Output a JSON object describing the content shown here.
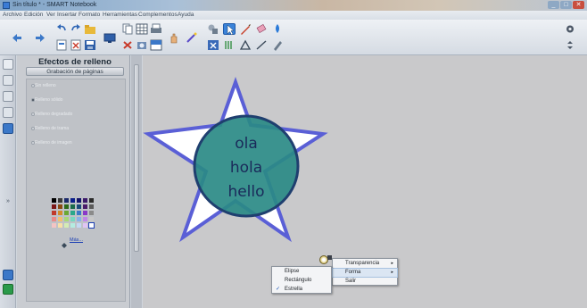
{
  "window": {
    "title": "Sin título * - SMART Notebook",
    "controls": [
      "minimize",
      "maximize",
      "close"
    ]
  },
  "menubar": {
    "items": [
      "Archivo",
      "Edición",
      "Ver",
      "Insertar",
      "Formato",
      "Herramientas",
      "Complementos",
      "Ayuda"
    ]
  },
  "properties_panel": {
    "title": "Efectos de relleno",
    "subtitle": "Grabación de páginas",
    "fill_options": [
      {
        "label": "Sin relleno",
        "selected": false
      },
      {
        "label": "Relleno sólido",
        "selected": true
      },
      {
        "label": "Relleno degradado",
        "selected": false
      },
      {
        "label": "Relleno de trama",
        "selected": false
      },
      {
        "label": "Relleno de imagen",
        "selected": false
      }
    ],
    "more_colors_link": "Más...",
    "palette": [
      "#000000",
      "#3a3a3a",
      "#1b2a6b",
      "#0b1f8a",
      "#14146a",
      "#3c1a6a",
      "#2a2a2a",
      "#7a1616",
      "#8a4a12",
      "#2e6a1a",
      "#1a6a4a",
      "#1a4a7a",
      "#4a1a6a",
      "#5a5a5a",
      "#c0392b",
      "#d38b2a",
      "#6aa832",
      "#2aa88a",
      "#3a7ac8",
      "#8a3ac8",
      "#8a8a8a",
      "#e88a8a",
      "#f0c070",
      "#a8d878",
      "#78d8c0",
      "#88b0e8",
      "#c088e8",
      "#c8c8c8",
      "#f4c4c4",
      "#f8e0a8",
      "#d4ecb4",
      "#b4ece0",
      "#c4d8f4",
      "#e0c4f4",
      "#ffffff"
    ]
  },
  "canvas": {
    "text_lines": [
      "ola",
      "hola",
      "hello"
    ],
    "star_fill": "#ffffff",
    "star_stroke": "#5a5fd6",
    "circle_fill": "#2a8a86",
    "circle_stroke": "#1f3f6f"
  },
  "context_menu_main": {
    "items": [
      {
        "label": "Transparencia",
        "has_submenu": true
      },
      {
        "label": "Forma",
        "has_submenu": true,
        "highlighted": true
      },
      {
        "label": "Salir",
        "has_submenu": false
      }
    ]
  },
  "context_menu_shape": {
    "items": [
      {
        "label": "Elipse",
        "checked": false
      },
      {
        "label": "Rectángulo",
        "checked": false
      },
      {
        "label": "Estrella",
        "checked": true
      }
    ]
  },
  "icons": {
    "back": "arrow-left-icon",
    "forward": "arrow-right-icon",
    "undo": "undo-icon",
    "redo": "redo-icon",
    "select": "pointer-icon",
    "pen": "pen-icon",
    "eraser": "eraser-icon",
    "line": "line-icon",
    "shapes": "shapes-icon",
    "text": "text-icon",
    "settings": "gear-icon",
    "more": "expand-icon"
  }
}
